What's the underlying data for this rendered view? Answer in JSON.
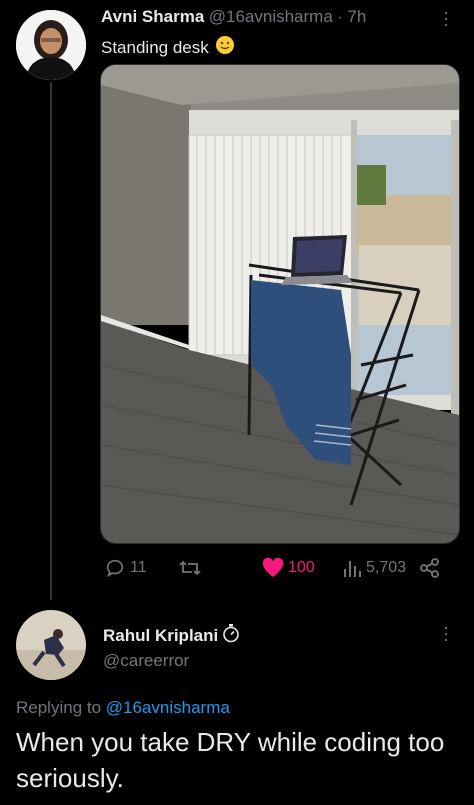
{
  "tweet": {
    "author_name": "Avni Sharma",
    "handle": "@16avnisharma",
    "separator": "·",
    "time": "7h",
    "text": "Standing desk",
    "emoji_icon": "smiling-face-emoji",
    "media_description_icon": "photo",
    "stats": {
      "replies": "11",
      "retweets": "",
      "likes": "100",
      "views": "5,703"
    },
    "like_color": "#f91880"
  },
  "reply": {
    "author_name": "Rahul Kriplani",
    "badge_icon": "stopwatch-icon",
    "handle": "@careerror",
    "replying_prefix": "Replying to",
    "replying_to": "@16avnisharma",
    "text": "When you take DRY while coding too seriously.",
    "link_color": "#1d9bf0"
  },
  "colors": {
    "background": "#000000",
    "primary_text": "#e7e9ea",
    "secondary_text": "#71767b"
  }
}
